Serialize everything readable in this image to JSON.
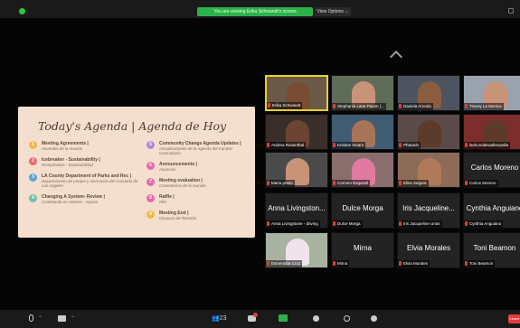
{
  "top_bar": {
    "share_banner": "You are viewing Erika Schwandt's screen",
    "view_options": "View Options ⌄"
  },
  "slide": {
    "title": "Today's Agenda | Agenda de Hoy",
    "left_items": [
      {
        "n": "1",
        "color": "#f2b84b",
        "title": "Meeting Agreements |",
        "subtitle": "Acuerdos de la reunión"
      },
      {
        "n": "2",
        "color": "#e86a6a",
        "title": "Icebreaker - Sustainability |",
        "subtitle": "Rompehielos - Sostenibilidad"
      },
      {
        "n": "3",
        "color": "#5aa3d8",
        "title": "LA County Department of Parks and Rec |",
        "subtitle": "Departamento de parque y recreación del Condado de Los Angeles"
      },
      {
        "n": "4",
        "color": "#6fc0a8",
        "title": "Changing A System- Review |",
        "subtitle": "Cambiando un sistema - repaso"
      }
    ],
    "right_items": [
      {
        "n": "5",
        "color": "#a98bd6",
        "title": "Community Change Agenda Updates |",
        "subtitle": "Actualizaciones de la Agenda del Cambio Comunitario"
      },
      {
        "n": "6",
        "color": "#e86aa6",
        "title": "Announcements |",
        "subtitle": "Anuncios"
      },
      {
        "n": "7",
        "color": "#e86aa6",
        "title": "Meeting evaluation |",
        "subtitle": "Comentarios de la reunión"
      },
      {
        "n": "8",
        "color": "#e86aa6",
        "title": "Raffle |",
        "subtitle": "Rifa"
      },
      {
        "n": "9",
        "color": "#f2b84b",
        "title": "Meeting End |",
        "subtitle": "Clausura de Reunión"
      }
    ]
  },
  "participants": {
    "r1": [
      {
        "label": "Erika Schwandt",
        "bg": "#6b5a48",
        "skin": "#7a4c32"
      },
      {
        "label": "Stephanie Lane Pavon (...",
        "bg": "#5f6c58",
        "skin": "#c99378"
      },
      {
        "label": "Daniela Arreola",
        "bg": "#4e5360",
        "skin": "#8a5c40"
      },
      {
        "label": "Tracey La Monica",
        "bg": "#9aa3ad",
        "skin": "#c99378"
      }
    ],
    "r2": [
      {
        "label": "Andrea Rosenthal",
        "bg": "#3a2e2a",
        "skin": "#6c4433"
      },
      {
        "label": "Kristine Amaro",
        "bg": "#3f5c73",
        "skin": "#a87458"
      },
      {
        "label": "Pharaoh",
        "bg": "#5a4a4a",
        "skin": "#5c3b2b"
      },
      {
        "label": "lashundakwalkerpalla",
        "bg": "#7c2e2e",
        "skin": "#5c3b2b"
      }
    ],
    "r3_video": [
      {
        "label": "Maria prieto",
        "bg": "#4a4a4a",
        "skin": "#c99378"
      },
      {
        "label": "Carmen Esquivel",
        "bg": "#8a6d6d",
        "skin": "#e07aa0"
      },
      {
        "label": "Elisa Segura",
        "bg": "#8c6c58",
        "skin": "#b07a5a"
      }
    ],
    "r3_name": {
      "name": "Carlos Moreno",
      "label": "Carlos Moreno"
    },
    "r4": [
      {
        "name": "Anna Livingston...",
        "label": "Anna Livingstone - driving"
      },
      {
        "name": "Dulce Morga",
        "label": "Dulce Morga"
      },
      {
        "name": "Iris Jacqueline...",
        "label": "Iris Jacqueline Urias"
      },
      {
        "name": "Cynthia Anguiano",
        "label": "Cynthia Anguiano"
      }
    ],
    "r5_video": {
      "label": "Esmeralda Cruz",
      "bg": "#a7b3a0",
      "skin": "#f1e3ec"
    },
    "r5": [
      {
        "name": "Mirna",
        "label": "Mirna"
      },
      {
        "name": "Elvia Morales",
        "label": "Elvia Morales"
      },
      {
        "name": "Toni Beamon",
        "label": "Toni Beamon"
      }
    ]
  },
  "bottom_bar": {
    "people_count": "23",
    "leave_label": "Leave"
  }
}
